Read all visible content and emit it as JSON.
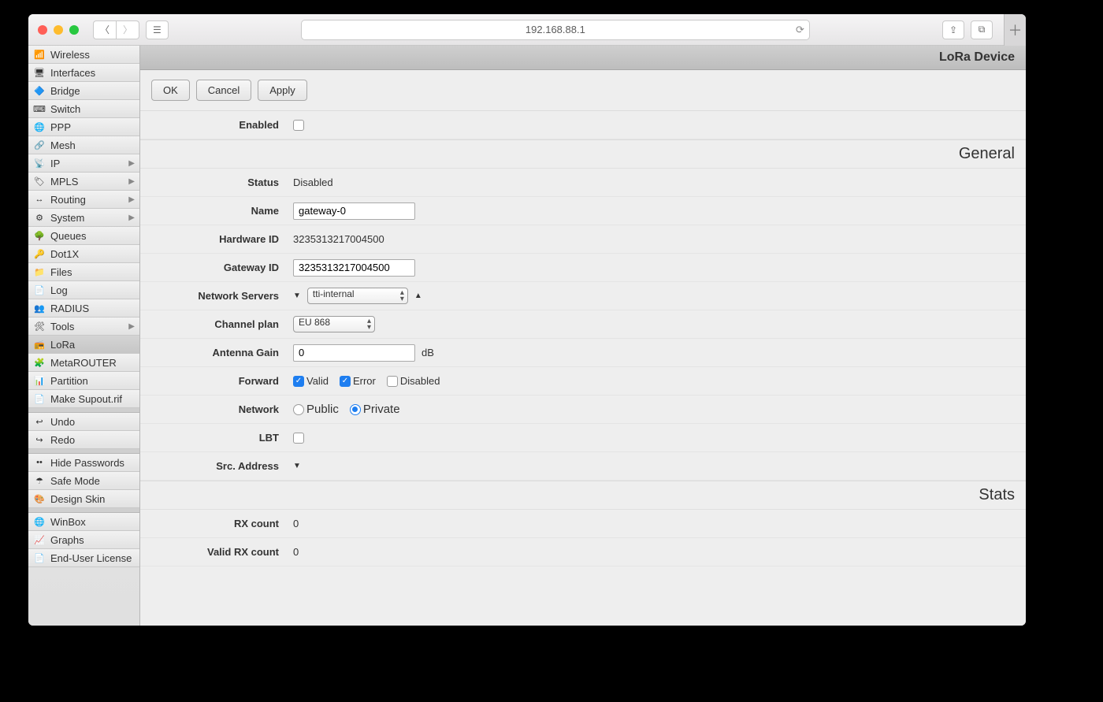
{
  "titlebar": {
    "address": "192.168.88.1"
  },
  "sidebar": {
    "groups": [
      [
        {
          "label": "Wireless",
          "icon": "📶",
          "sub": false
        },
        {
          "label": "Interfaces",
          "icon": "🖥",
          "sub": false
        },
        {
          "label": "Bridge",
          "icon": "🔷",
          "sub": false
        },
        {
          "label": "Switch",
          "icon": "⌨",
          "sub": false
        },
        {
          "label": "PPP",
          "icon": "🌐",
          "sub": false
        },
        {
          "label": "Mesh",
          "icon": "🔗",
          "sub": false
        },
        {
          "label": "IP",
          "icon": "📡",
          "sub": true
        },
        {
          "label": "MPLS",
          "icon": "🏷",
          "sub": true
        },
        {
          "label": "Routing",
          "icon": "↔",
          "sub": true
        },
        {
          "label": "System",
          "icon": "⚙",
          "sub": true
        },
        {
          "label": "Queues",
          "icon": "🌳",
          "sub": false
        },
        {
          "label": "Dot1X",
          "icon": "🔑",
          "sub": false
        },
        {
          "label": "Files",
          "icon": "📁",
          "sub": false
        },
        {
          "label": "Log",
          "icon": "📄",
          "sub": false
        },
        {
          "label": "RADIUS",
          "icon": "👥",
          "sub": false
        },
        {
          "label": "Tools",
          "icon": "🛠",
          "sub": true
        },
        {
          "label": "LoRa",
          "icon": "📻",
          "sub": false,
          "selected": true
        },
        {
          "label": "MetaROUTER",
          "icon": "🧩",
          "sub": false
        },
        {
          "label": "Partition",
          "icon": "📊",
          "sub": false
        },
        {
          "label": "Make Supout.rif",
          "icon": "📄",
          "sub": false
        }
      ],
      [
        {
          "label": "Undo",
          "icon": "↩",
          "sub": false
        },
        {
          "label": "Redo",
          "icon": "↪",
          "sub": false
        }
      ],
      [
        {
          "label": "Hide Passwords",
          "icon": "••",
          "sub": false
        },
        {
          "label": "Safe Mode",
          "icon": "☂",
          "sub": false
        },
        {
          "label": "Design Skin",
          "icon": "🎨",
          "sub": false
        }
      ],
      [
        {
          "label": "WinBox",
          "icon": "🌐",
          "sub": false
        },
        {
          "label": "Graphs",
          "icon": "📈",
          "sub": false
        },
        {
          "label": "End-User License",
          "icon": "📄",
          "sub": false
        }
      ]
    ]
  },
  "page": {
    "title": "LoRa Device",
    "buttons": {
      "ok": "OK",
      "cancel": "Cancel",
      "apply": "Apply"
    },
    "sections": {
      "general": "General",
      "stats": "Stats"
    },
    "labels": {
      "enabled": "Enabled",
      "status": "Status",
      "name": "Name",
      "hardware_id": "Hardware ID",
      "gateway_id": "Gateway ID",
      "network_servers": "Network Servers",
      "channel_plan": "Channel plan",
      "antenna_gain": "Antenna Gain",
      "forward": "Forward",
      "network": "Network",
      "lbt": "LBT",
      "src_address": "Src. Address",
      "rx_count": "RX count",
      "valid_rx_count": "Valid RX count"
    },
    "values": {
      "enabled": false,
      "status": "Disabled",
      "name": "gateway-0",
      "hardware_id": "3235313217004500",
      "gateway_id": "3235313217004500",
      "network_server_selected": "tti-internal",
      "channel_plan": "EU 868",
      "antenna_gain": "0",
      "antenna_gain_unit": "dB",
      "forward": {
        "valid": {
          "label": "Valid",
          "checked": true
        },
        "error": {
          "label": "Error",
          "checked": true
        },
        "disabled": {
          "label": "Disabled",
          "checked": false
        }
      },
      "network": {
        "public": {
          "label": "Public",
          "selected": false
        },
        "private": {
          "label": "Private",
          "selected": true
        }
      },
      "lbt": false,
      "rx_count": "0",
      "valid_rx_count": "0"
    }
  }
}
